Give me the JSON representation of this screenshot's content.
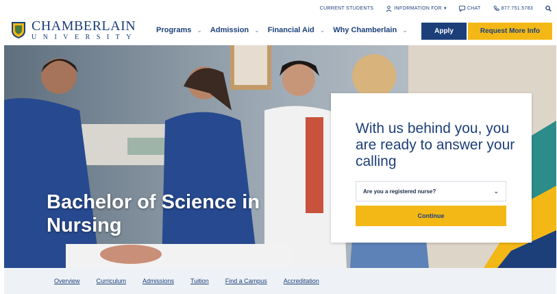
{
  "utility": {
    "current_students": "CURRENT STUDENTS",
    "information_for": "INFORMATION FOR",
    "chat": "CHAT",
    "phone": "877.751.5783"
  },
  "header": {
    "logo_name": "CHAMBERLAIN",
    "logo_sub": "UNIVERSITY",
    "nav": [
      {
        "label": "Programs"
      },
      {
        "label": "Admission"
      },
      {
        "label": "Financial Aid"
      },
      {
        "label": "Why Chamberlain"
      }
    ],
    "apply_label": "Apply",
    "request_label": "Request More Info"
  },
  "hero": {
    "title": "Bachelor of Science in Nursing"
  },
  "card": {
    "heading": "With us behind you, you are ready to answer your calling",
    "select_value": "Are you a registered nurse?",
    "continue_label": "Continue"
  },
  "subnav": {
    "links": [
      "Overview",
      "Curriculum",
      "Admissions",
      "Tuition",
      "Find a Campus",
      "Accreditation"
    ]
  },
  "colors": {
    "navy": "#1c3f7a",
    "gold": "#f3b816",
    "subnav_bg": "#eef2f6"
  }
}
